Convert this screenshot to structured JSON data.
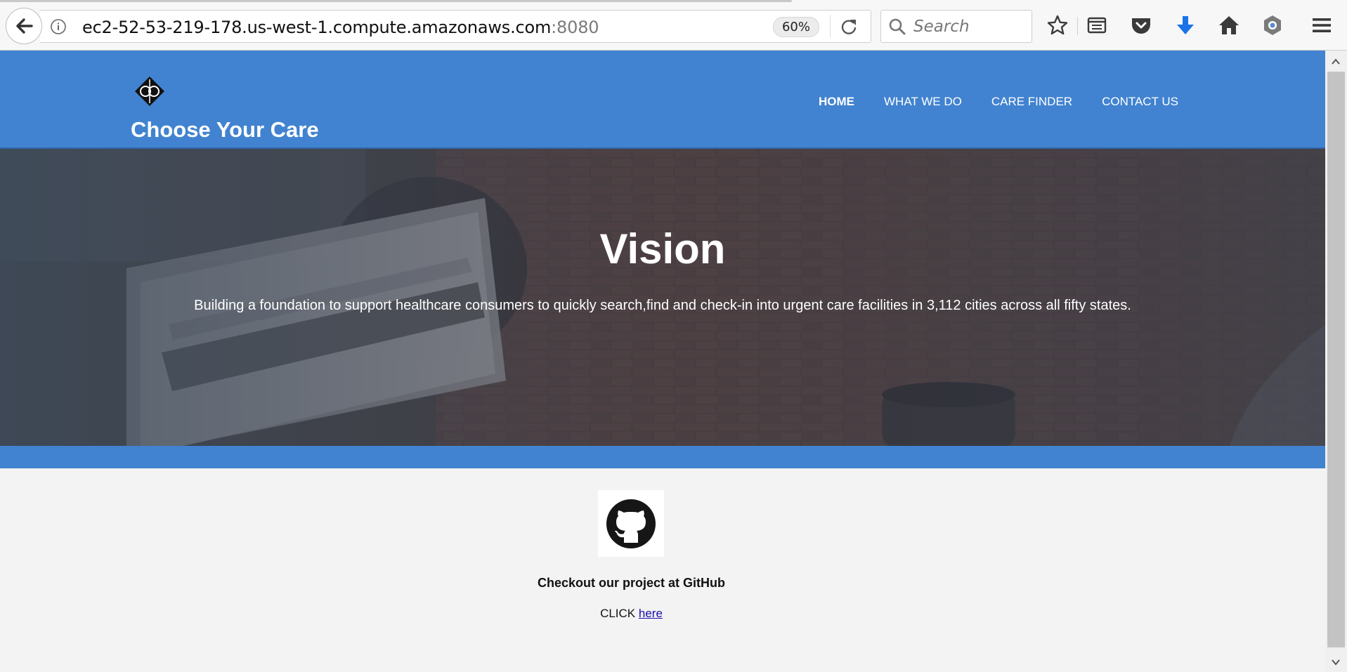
{
  "browser": {
    "url_host": "ec2-52-53-219-178.us-west-1.compute.amazonaws.com",
    "url_port": ":8080",
    "zoom": "60%",
    "search_placeholder": "Search",
    "toolbar_icons": [
      "back-arrow-icon",
      "info-icon",
      "reload-icon",
      "search-icon",
      "bookmark-star-icon",
      "reader-view-icon",
      "pocket-icon",
      "download-icon",
      "home-icon",
      "extension-icon",
      "menu-icon"
    ],
    "accent_color": "#1a73e8"
  },
  "site": {
    "brand": "Choose Your Care",
    "nav": [
      {
        "label": "HOME",
        "active": true
      },
      {
        "label": "WHAT WE DO",
        "active": false
      },
      {
        "label": "CARE FINDER",
        "active": false
      },
      {
        "label": "CONTACT US",
        "active": false
      }
    ],
    "header_color": "#4183d0"
  },
  "hero": {
    "title": "Vision",
    "text": "Building a foundation to support healthcare consumers to quickly search,find and check-in into urgent care facilities in 3,112 cities across all fifty states."
  },
  "github": {
    "heading": "Checkout our project at GitHub",
    "click_prefix": "CLICK",
    "link_label": "here"
  }
}
